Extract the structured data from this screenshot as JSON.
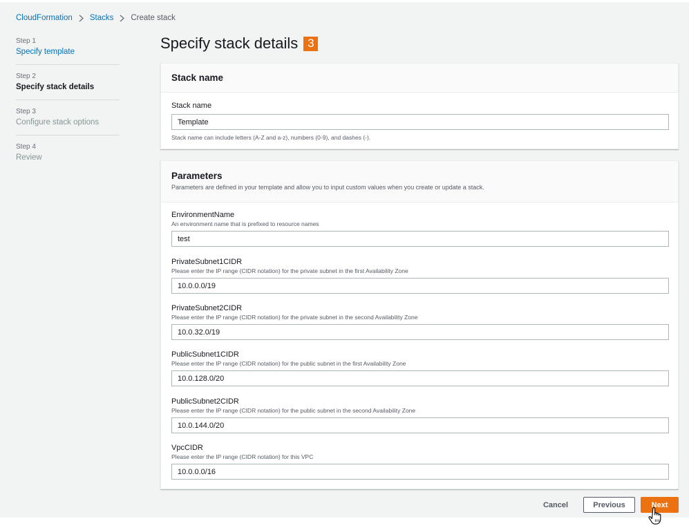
{
  "breadcrumb": {
    "items": [
      {
        "label": "CloudFormation"
      },
      {
        "label": "Stacks"
      },
      {
        "label": "Create stack"
      }
    ]
  },
  "steps": [
    {
      "number": "Step 1",
      "label": "Specify template",
      "state": "link"
    },
    {
      "number": "Step 2",
      "label": "Specify stack details",
      "state": "active"
    },
    {
      "number": "Step 3",
      "label": "Configure stack options",
      "state": "disabled"
    },
    {
      "number": "Step 4",
      "label": "Review",
      "state": "disabled"
    }
  ],
  "page": {
    "title": "Specify stack details",
    "badge": "3"
  },
  "stack_name_panel": {
    "title": "Stack name",
    "field_label": "Stack name",
    "value": "Template",
    "hint": "Stack name can include letters (A-Z and a-z), numbers (0-9), and dashes (-)."
  },
  "parameters_panel": {
    "title": "Parameters",
    "description": "Parameters are defined in your template and allow you to input custom values when you create or update a stack.",
    "fields": [
      {
        "label": "EnvironmentName",
        "description": "An environment name that is prefixed to resource names",
        "value": "test"
      },
      {
        "label": "PrivateSubnet1CIDR",
        "description": "Please enter the IP range (CIDR notation) for the private subnet in the first Availability Zone",
        "value": "10.0.0.0/19"
      },
      {
        "label": "PrivateSubnet2CIDR",
        "description": "Please enter the IP range (CIDR notation) for the private subnet in the second Availability Zone",
        "value": "10.0.32.0/19"
      },
      {
        "label": "PublicSubnet1CIDR",
        "description": "Please enter the IP range (CIDR notation) for the public subnet in the first Availability Zone",
        "value": "10.0.128.0/20"
      },
      {
        "label": "PublicSubnet2CIDR",
        "description": "Please enter the IP range (CIDR notation) for the public subnet in the second Availability Zone",
        "value": "10.0.144.0/20"
      },
      {
        "label": "VpcCIDR",
        "description": "Please enter the IP range (CIDR notation) for this VPC",
        "value": "10.0.0.0/16"
      }
    ]
  },
  "footer": {
    "cancel": "Cancel",
    "previous": "Previous",
    "next": "Next"
  },
  "colors": {
    "accent": "#ec7211",
    "link": "#0073bb",
    "background": "#f2f3f3"
  },
  "icons": {
    "breadcrumb_separator": "chevron-right-icon",
    "cursor": "hand-pointer-icon"
  }
}
